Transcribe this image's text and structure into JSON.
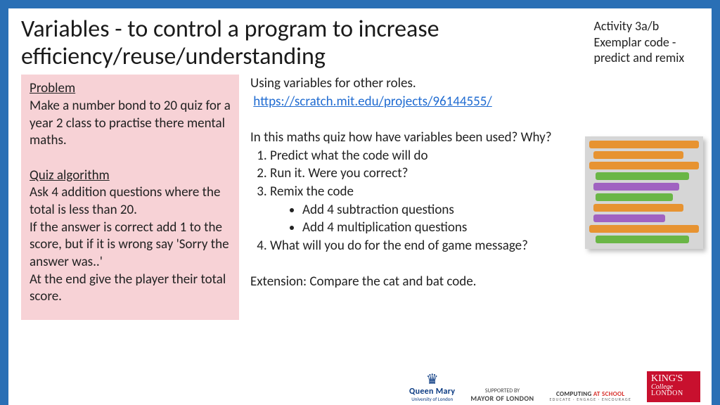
{
  "title": "Variables - to control a program to increase efficiency/reuse/understanding",
  "corner": {
    "line1": "Activity 3a/b",
    "line2": "Exemplar code  - predict and remix"
  },
  "pink": {
    "h1": "Problem",
    "p1": "Make a number bond to 20 quiz for a year 2 class to practise there mental maths.",
    "h2": "Quiz algorithm",
    "p2a": "Ask 4 addition questions where the total is less than 20.",
    "p2b": "If the answer is correct add 1 to the score, but if it is wrong say 'Sorry the answer was..'",
    "p2c": "At the end give the player their total score."
  },
  "right": {
    "intro": "Using variables for other roles.",
    "link": "https://scratch.mit.edu/projects/96144555/",
    "q": "In this maths quiz how have variables been used? Why?",
    "li1": "Predict what the code will do",
    "li2": "Run it. Were you correct?",
    "li3": "Remix the code",
    "li3a": "Add 4 subtraction questions",
    "li3b": "Add 4 multiplication questions",
    "li4": "What will you do for the end of game message?",
    "ext": "Extension: Compare the cat and bat code."
  },
  "logos": {
    "qm_name": "Queen Mary",
    "qm_sub": "University of London",
    "mol_sup": "SUPPORTED BY",
    "mol": "MAYOR OF LONDON",
    "cas_a": "COMPUTING ",
    "cas_b": "AT SCHOOL",
    "cas_sub": "EDUCATE · ENGAGE · ENCOURAGE",
    "k1": "KING'S",
    "k2": "College",
    "k3": "LONDON"
  }
}
